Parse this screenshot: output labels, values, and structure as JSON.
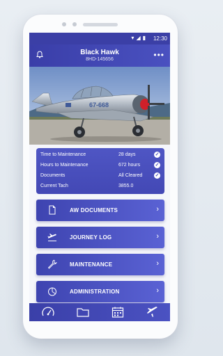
{
  "status_bar": {
    "time": "12:30"
  },
  "header": {
    "title": "Black Hawk",
    "subtitle": "8HD-145656"
  },
  "hero": {
    "aircraft_registration": "67-668"
  },
  "summary": [
    {
      "label": "Time to Maintenance",
      "value": "28 days",
      "checked": true
    },
    {
      "label": "Hours to Maintenance",
      "value": "672 hours",
      "checked": true
    },
    {
      "label": "Documents",
      "value": "All Cleared",
      "checked": true
    },
    {
      "label": "Current Tach",
      "value": "3855.0",
      "checked": false
    }
  ],
  "menu": [
    {
      "label": "AW DOCUMENTS",
      "icon": "document-icon"
    },
    {
      "label": "JOURNEY LOG",
      "icon": "airplane-icon"
    },
    {
      "label": "MAINTENANCE",
      "icon": "wrench-icon"
    },
    {
      "label": "ADMINISTRATION",
      "icon": "pie-chart-icon"
    }
  ],
  "bottom_nav": [
    "speedometer-icon",
    "folder-icon",
    "calendar-icon",
    "airplane-icon"
  ],
  "colors": {
    "primary": "#3b3fa6",
    "accent": "#5a62d4"
  }
}
